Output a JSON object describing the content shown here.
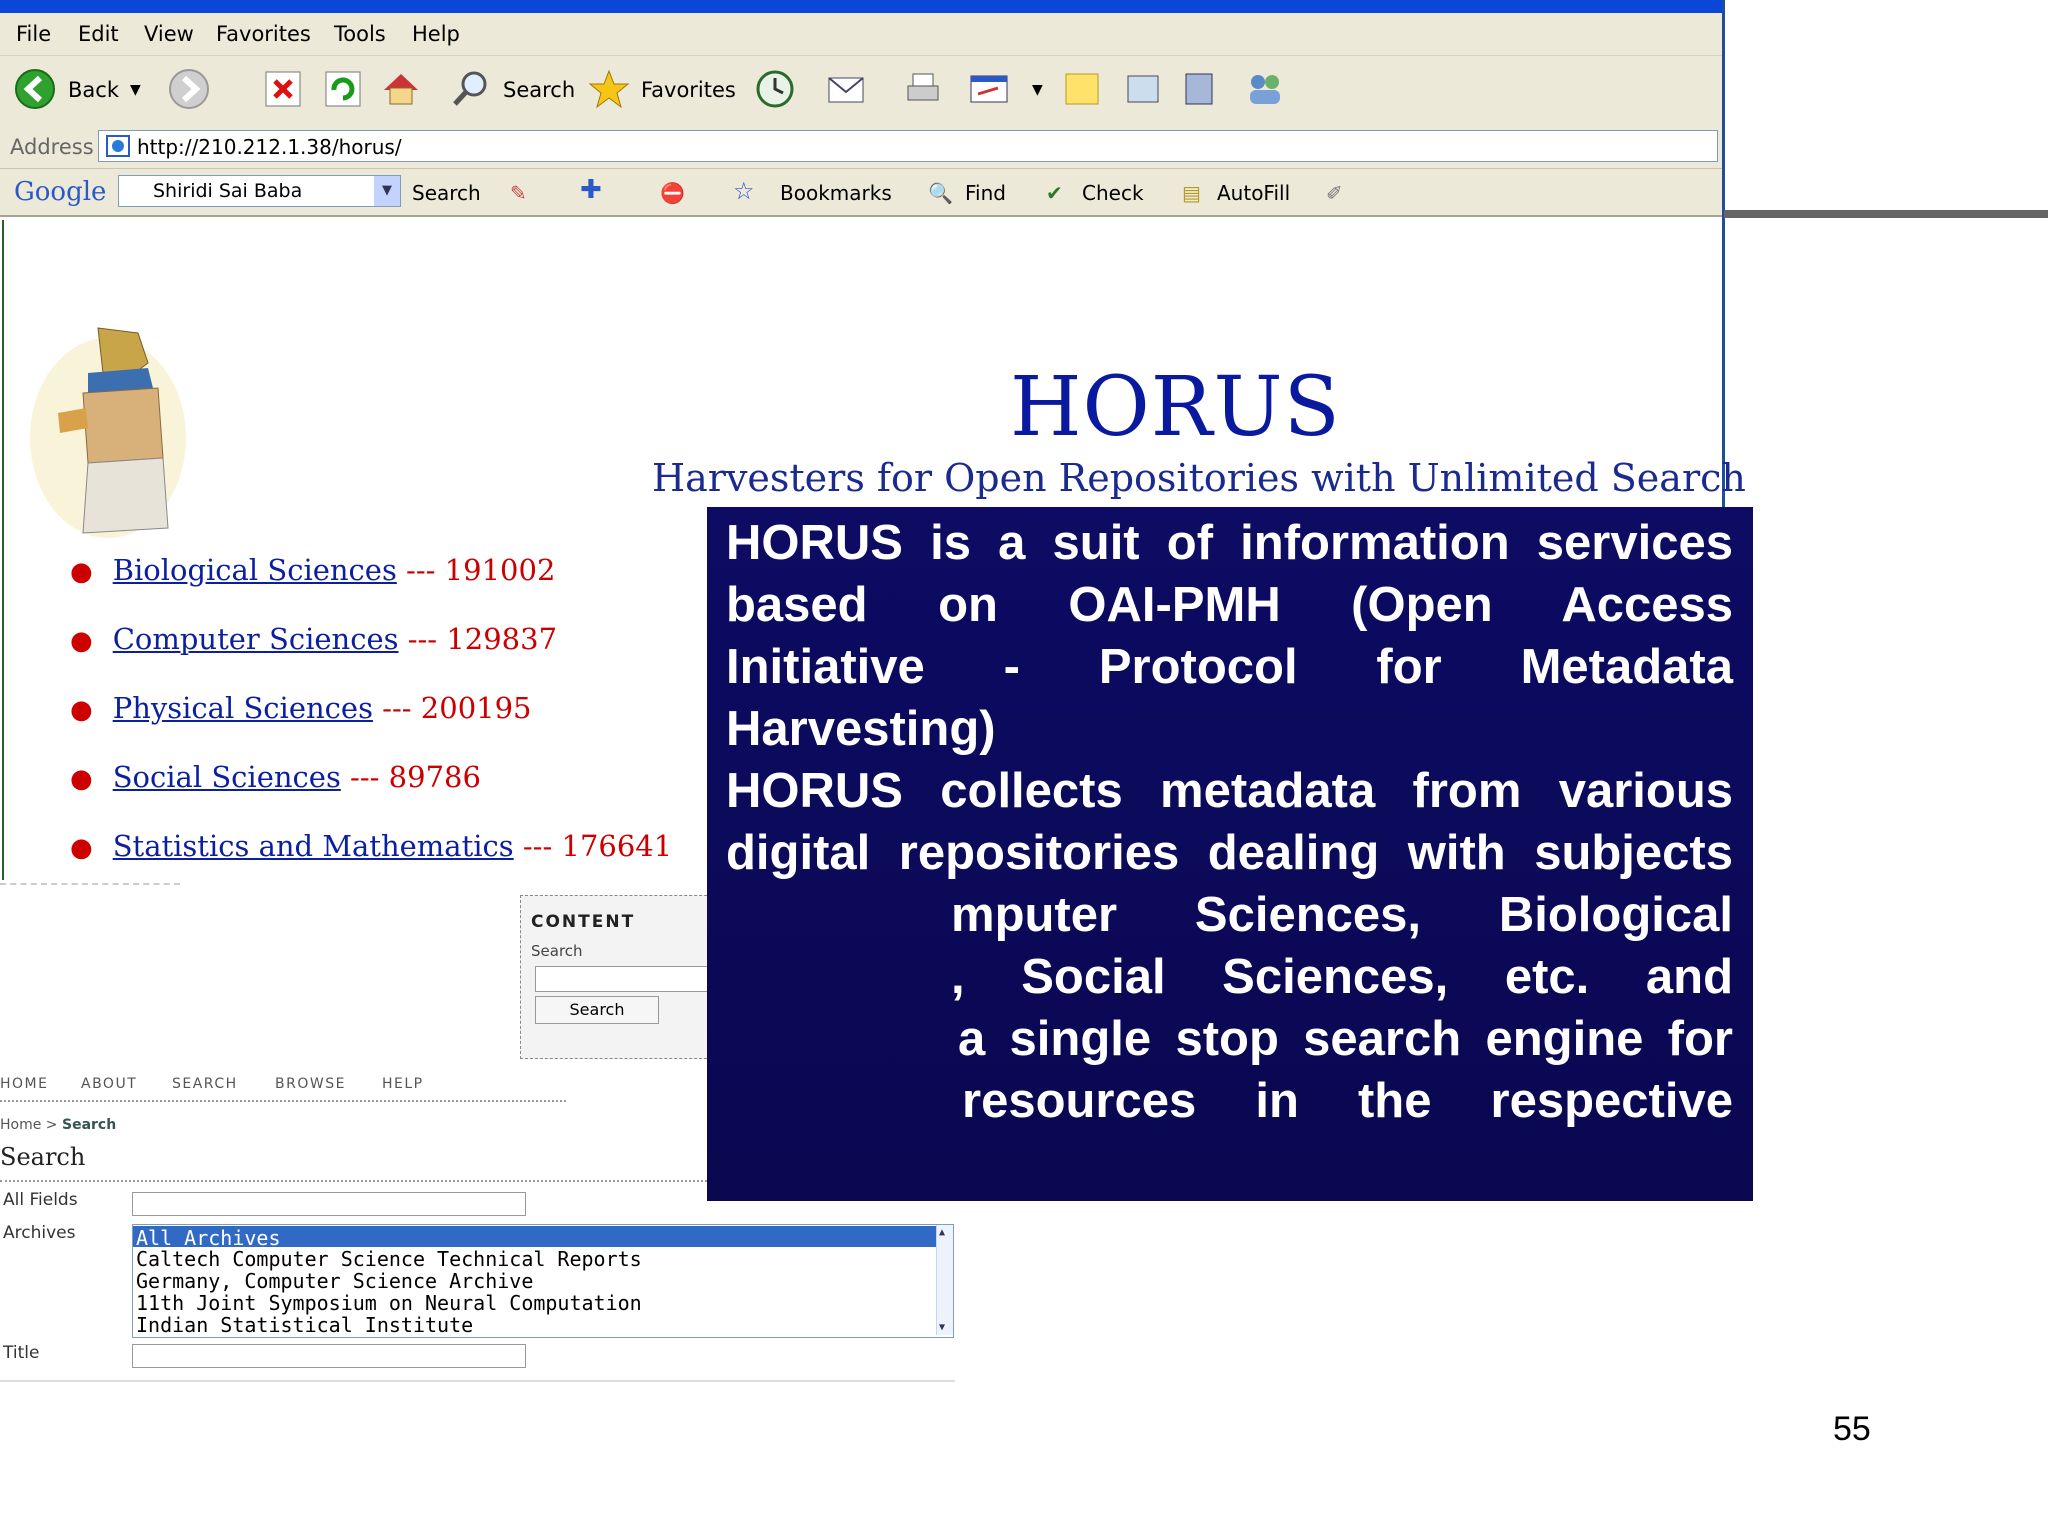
{
  "browser": {
    "menu": [
      "File",
      "Edit",
      "View",
      "Favorites",
      "Tools",
      "Help"
    ],
    "toolbar": {
      "back_label": "Back",
      "search_label": "Search",
      "favorites_label": "Favorites"
    },
    "address": {
      "label": "Address",
      "url": "http://210.212.1.38/horus/"
    },
    "google_bar": {
      "logo": "Google",
      "query": "Shiridi Sai Baba",
      "search_label": "Search",
      "bookmarks_label": "Bookmarks",
      "find_label": "Find",
      "check_label": "Check",
      "autofill_label": "AutoFill"
    }
  },
  "page": {
    "title": "HORUS",
    "subtitle": "Harvesters for Open Repositories with Unlimited Search",
    "subjects": [
      {
        "name": "Biological Sciences",
        "sep": " --- ",
        "count": "191002"
      },
      {
        "name": "Computer Sciences",
        "sep": " --- ",
        "count": "129837"
      },
      {
        "name": "Physical Sciences",
        "sep": " --- ",
        "count": "200195"
      },
      {
        "name": "Social Sciences",
        "sep": " --- ",
        "count": "89786"
      },
      {
        "name": "Statistics and Mathematics",
        "sep": " --- ",
        "count": "176641"
      }
    ]
  },
  "search_form": {
    "content_box": {
      "heading": "CONTENT",
      "search_label": "Search",
      "search_button": "Search"
    },
    "nav": [
      "HOME",
      "ABOUT",
      "SEARCH",
      "BROWSE",
      "HELP"
    ],
    "breadcrumb_home": "Home",
    "breadcrumb_sep": " > ",
    "breadcrumb_current": "Search",
    "heading": "Search",
    "all_fields_label": "All Fields",
    "archives_label": "Archives",
    "title_label": "Title",
    "archives": [
      "All Archives",
      "Caltech Computer Science Technical Reports",
      "Germany, Computer Science Archive",
      "11th Joint Symposium on Neural Computation",
      "Indian Statistical Institute"
    ],
    "selected_archive": "All Archives"
  },
  "overlay": {
    "text": "HORUS is a suit of information services based on OAI-PMH (Open Access Initiative - Protocol for Metadata Harvesting) HORUS collects metadata from various digital repositories dealing with subjects like Computer Sciences, Biological Sciences, Social Sciences, etc. and provides a single stop search engine for the resources in the respective",
    "lines": [
      "HORUS is a suit of information services",
      "based on OAI-PMH (Open Access",
      "Initiative - Protocol for Metadata",
      "Harvesting)",
      "HORUS collects metadata from various",
      "digital repositories dealing with subjects",
      "mputer Sciences, Biological",
      ", Social Sciences, etc. and",
      "a single stop search engine for",
      "resources in the respective"
    ]
  },
  "slide": {
    "page_number": "55"
  }
}
